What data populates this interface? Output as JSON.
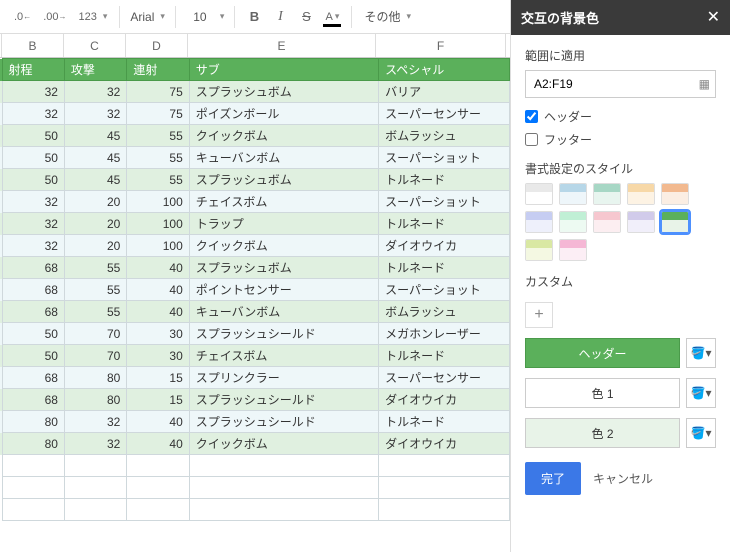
{
  "toolbar": {
    "decimal_dec": ".0",
    "decimal_inc": ".00",
    "format_more": "123",
    "font_name": "Arial",
    "font_size": "10",
    "bold": "B",
    "italic": "I",
    "strike": "S",
    "textcolor": "A",
    "etc_label": "その他"
  },
  "columns": [
    "B",
    "C",
    "D",
    "E",
    "F"
  ],
  "table": {
    "header": [
      "射程",
      "攻撃",
      "連射",
      "サブ",
      "スペシャル"
    ],
    "rows": [
      [
        "32",
        "32",
        "75",
        "スプラッシュボム",
        "バリア"
      ],
      [
        "32",
        "32",
        "75",
        "ポイズンボール",
        "スーパーセンサー"
      ],
      [
        "50",
        "45",
        "55",
        "クイックボム",
        "ボムラッシュ"
      ],
      [
        "50",
        "45",
        "55",
        "キューバンボム",
        "スーパーショット"
      ],
      [
        "50",
        "45",
        "55",
        "スプラッシュボム",
        "トルネード"
      ],
      [
        "32",
        "20",
        "100",
        "チェイスボム",
        "スーパーショット"
      ],
      [
        "32",
        "20",
        "100",
        "トラップ",
        "トルネード"
      ],
      [
        "32",
        "20",
        "100",
        "クイックボム",
        "ダイオウイカ"
      ],
      [
        "68",
        "55",
        "40",
        "スプラッシュボム",
        "トルネード"
      ],
      [
        "68",
        "55",
        "40",
        "ポイントセンサー",
        "スーパーショット"
      ],
      [
        "68",
        "55",
        "40",
        "キューバンボム",
        "ボムラッシュ"
      ],
      [
        "50",
        "70",
        "30",
        "スプラッシュシールド",
        "メガホンレーザー"
      ],
      [
        "50",
        "70",
        "30",
        "チェイスボム",
        "トルネード"
      ],
      [
        "68",
        "80",
        "15",
        "スプリンクラー",
        "スーパーセンサー"
      ],
      [
        "68",
        "80",
        "15",
        "スプラッシュシールド",
        "ダイオウイカ"
      ],
      [
        "80",
        "32",
        "40",
        "スプラッシュシールド",
        "トルネード"
      ],
      [
        "80",
        "32",
        "40",
        "クイックボム",
        "ダイオウイカ"
      ]
    ]
  },
  "panel": {
    "title": "交互の背景色",
    "range_label": "範囲に適用",
    "range_value": "A2:F19",
    "header_cb": "ヘッダー",
    "footer_cb": "フッター",
    "styles_label": "書式設定のスタイル",
    "styles": [
      {
        "top": "#e9e9e9",
        "bot": "#ffffff"
      },
      {
        "top": "#b7d7e8",
        "bot": "#eef6fa"
      },
      {
        "top": "#a7d7c5",
        "bot": "#e8f5ef"
      },
      {
        "top": "#f7d8a7",
        "bot": "#fdf3e4"
      },
      {
        "top": "#f2b98f",
        "bot": "#fbeee3"
      },
      {
        "top": "#c6cdf2",
        "bot": "#eef0fb"
      },
      {
        "top": "#c0efd5",
        "bot": "#edfaf2"
      },
      {
        "top": "#f6c7cf",
        "bot": "#fceef1"
      },
      {
        "top": "#d1cbea",
        "bot": "#f1effa"
      },
      {
        "top": "#5bb05b",
        "bot": "#e8f3e8",
        "selected": true
      },
      {
        "top": "#d9e8a3",
        "bot": "#f4f8e2"
      },
      {
        "top": "#f5b7d5",
        "bot": "#fceef5"
      }
    ],
    "custom_label": "カスタム",
    "header_color_label": "ヘッダー",
    "color1_label": "色 1",
    "color2_label": "色 2",
    "done": "完了",
    "cancel": "キャンセル"
  }
}
